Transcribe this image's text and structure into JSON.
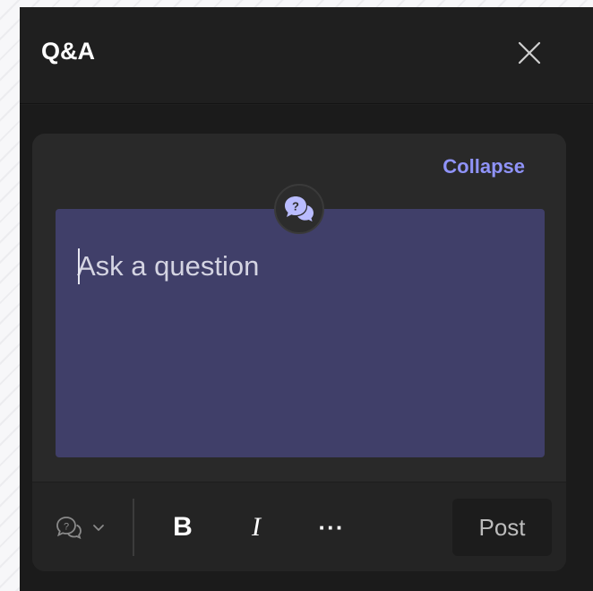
{
  "header": {
    "title": "Q&A"
  },
  "composer": {
    "collapse_label": "Collapse",
    "placeholder": "Ask a question"
  },
  "toolbar": {
    "bold_label": "B",
    "italic_label": "I",
    "more_label": "···",
    "post_label": "Post"
  },
  "icons": {
    "close": "close-icon",
    "qa_badge": "qa-bubble-icon",
    "type_picker": "question-bubble-icon",
    "chevron": "chevron-down-icon"
  },
  "colors": {
    "accent": "#8f93f8",
    "question_box": "#403f69",
    "panel_bg": "#1f1f1f",
    "card_bg": "#292929"
  }
}
